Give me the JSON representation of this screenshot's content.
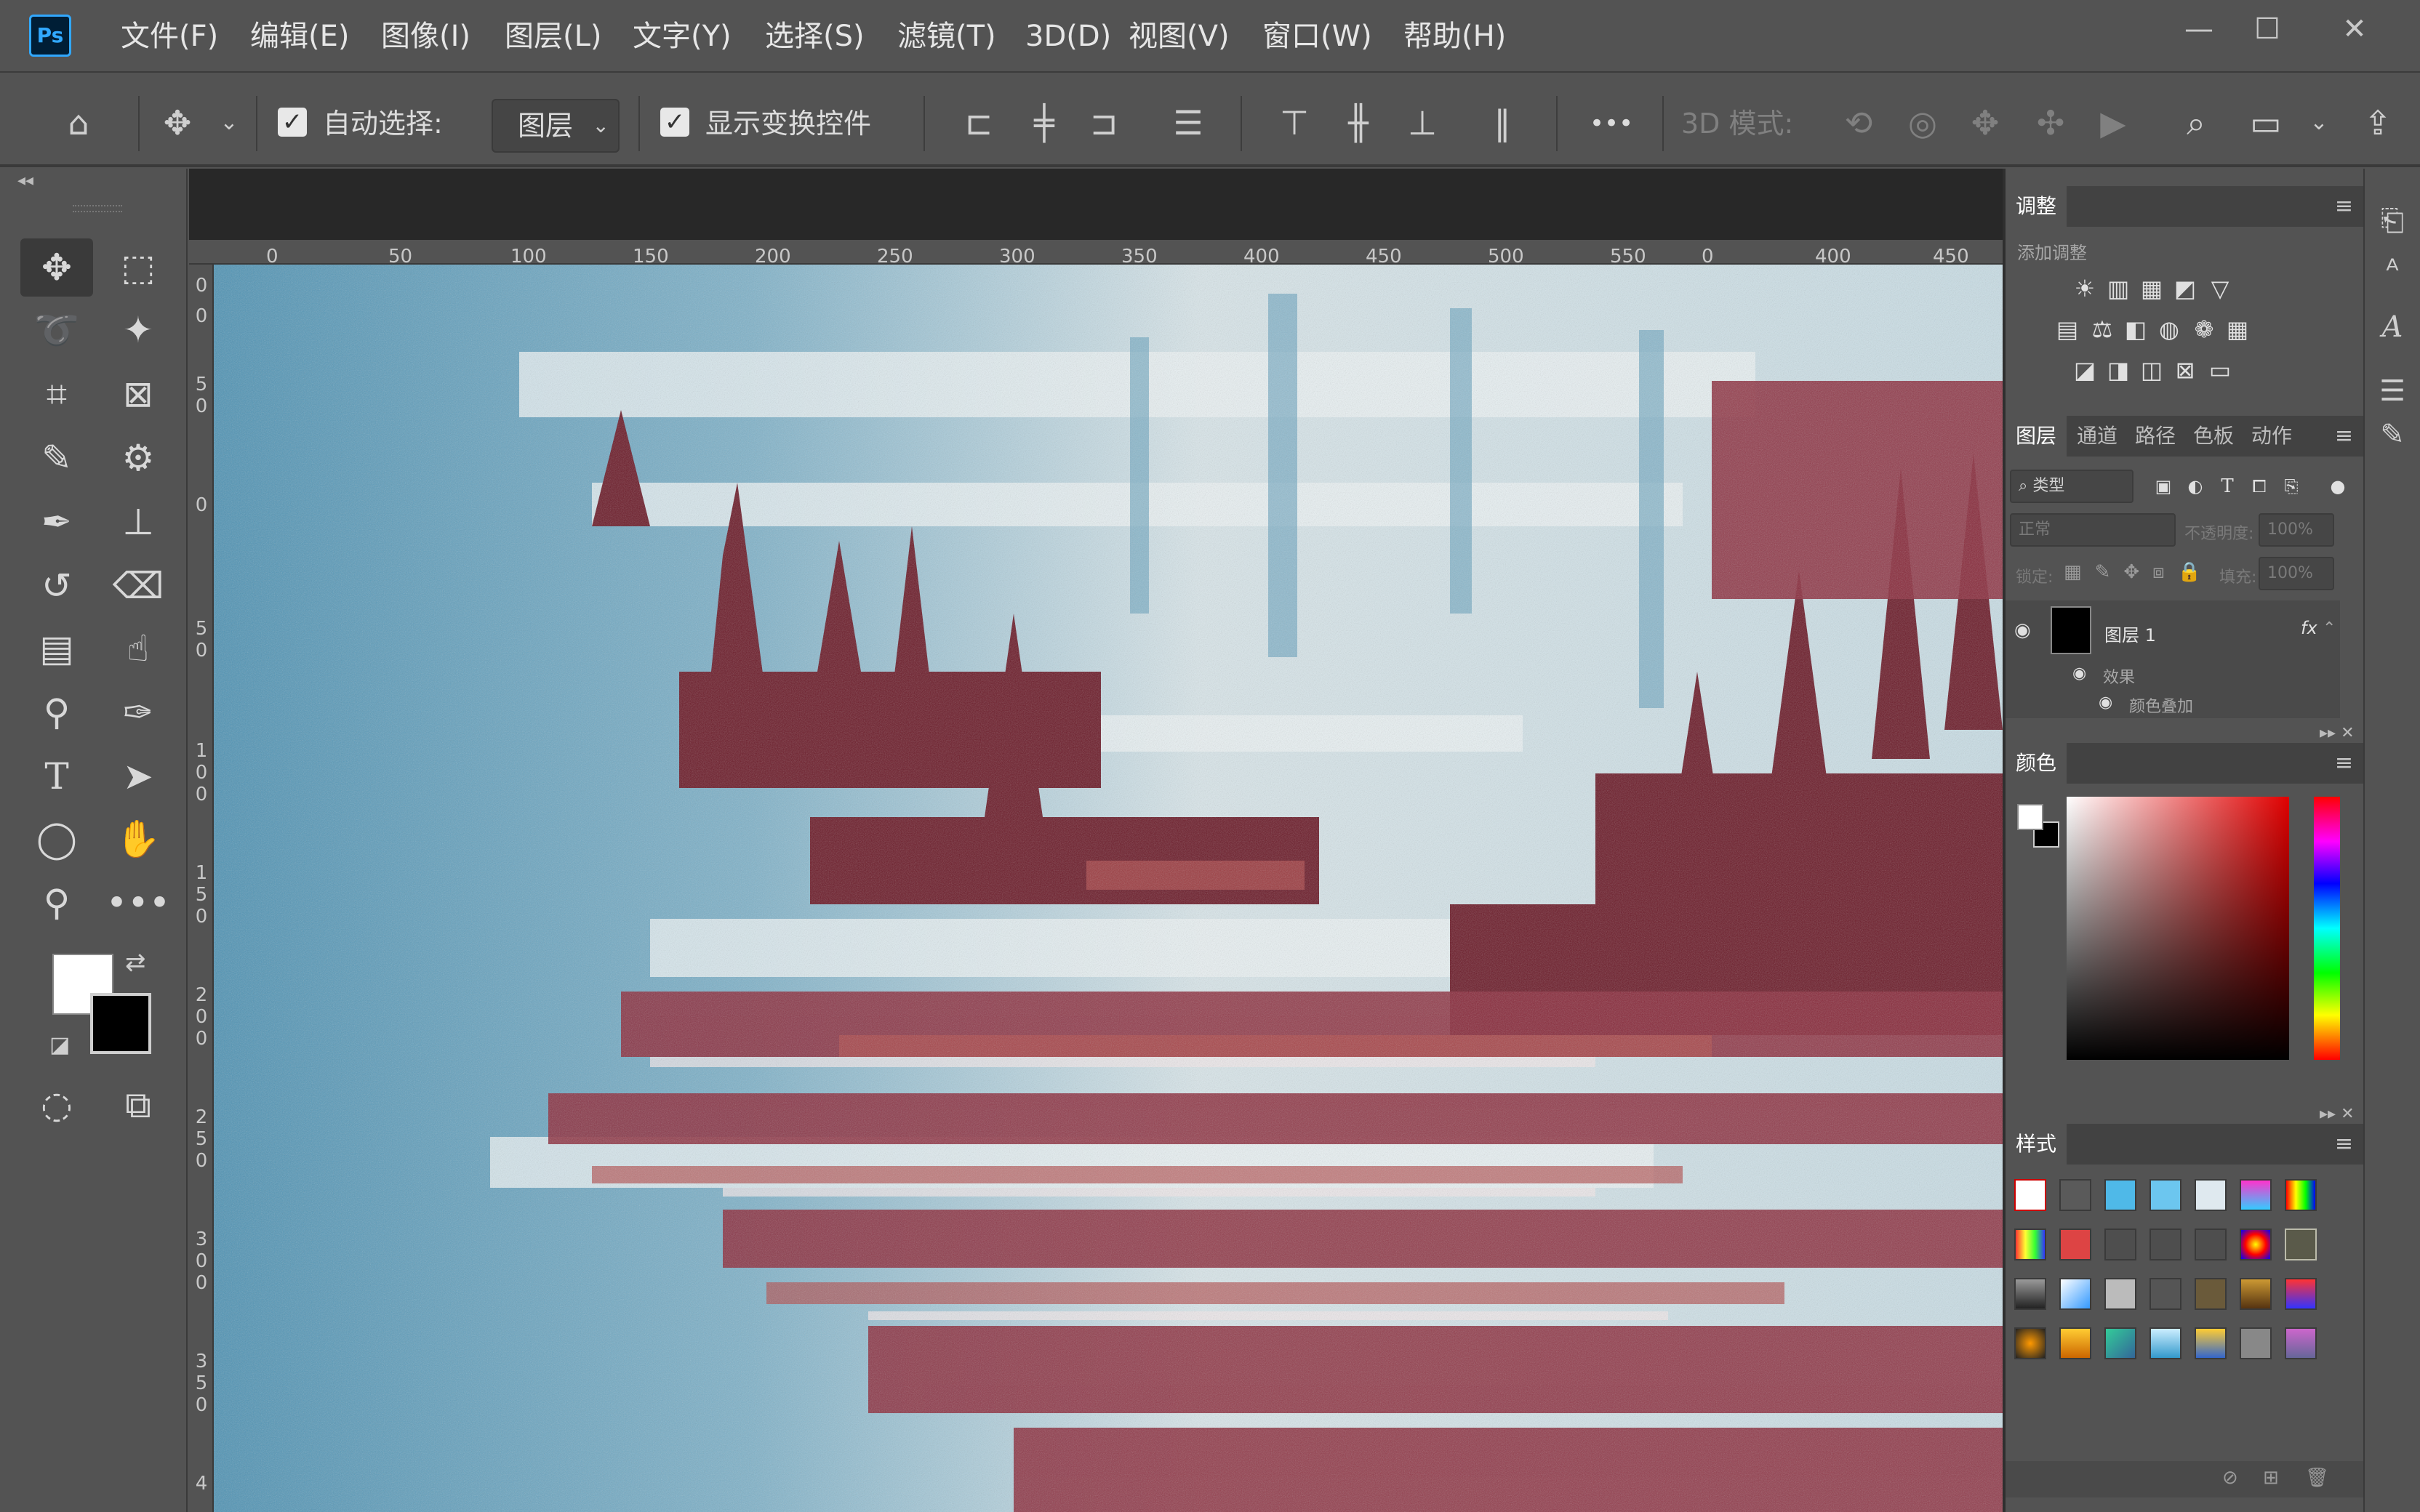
{
  "app": {
    "logo": "Ps"
  },
  "menu": [
    "文件(F)",
    "编辑(E)",
    "图像(I)",
    "图层(L)",
    "文字(Y)",
    "选择(S)",
    "滤镜(T)",
    "3D(D)",
    "视图(V)",
    "窗口(W)",
    "帮助(H)"
  ],
  "window_controls": {
    "minimize": "—",
    "maximize": "☐",
    "close": "✕"
  },
  "options": {
    "auto_select_label": "自动选择:",
    "auto_select_value": "图层",
    "show_transform_label": "显示变换控件",
    "more": "•••",
    "mode_3d_label": "3D 模式:"
  },
  "ruler": {
    "top_ticks": [
      "0",
      "50",
      "100",
      "150",
      "200",
      "250",
      "300",
      "350",
      "400",
      "450",
      "500",
      "550",
      "0",
      "400",
      "450"
    ],
    "left_ticks": [
      "0",
      "0",
      "5 0",
      "0",
      "5 0",
      "1 0 0",
      "1 5 0",
      "2 0 0",
      "2 5 0",
      "3 0 0",
      "3 5 0",
      "4"
    ]
  },
  "colors": {
    "foreground": "#ffffff",
    "background": "#000000",
    "accent": "#31a8ff"
  },
  "adjustments": {
    "tab": "调整",
    "add_label": "添加调整",
    "menu_icon": "≡"
  },
  "layers": {
    "tabs": [
      "图层",
      "通道",
      "路径",
      "色板",
      "动作"
    ],
    "filter_placeholder": "类型",
    "blend_mode": "正常",
    "opacity_label": "不透明度:",
    "opacity_value": "100%",
    "lock_label": "锁定:",
    "fill_label": "填充:",
    "fill_value": "100%",
    "layer_name": "图层 1",
    "fx": "fx",
    "effects_label": "效果",
    "effect_item": "颜色叠加"
  },
  "color_panel": {
    "tab": "颜色"
  },
  "styles_panel": {
    "tab": "样式"
  }
}
